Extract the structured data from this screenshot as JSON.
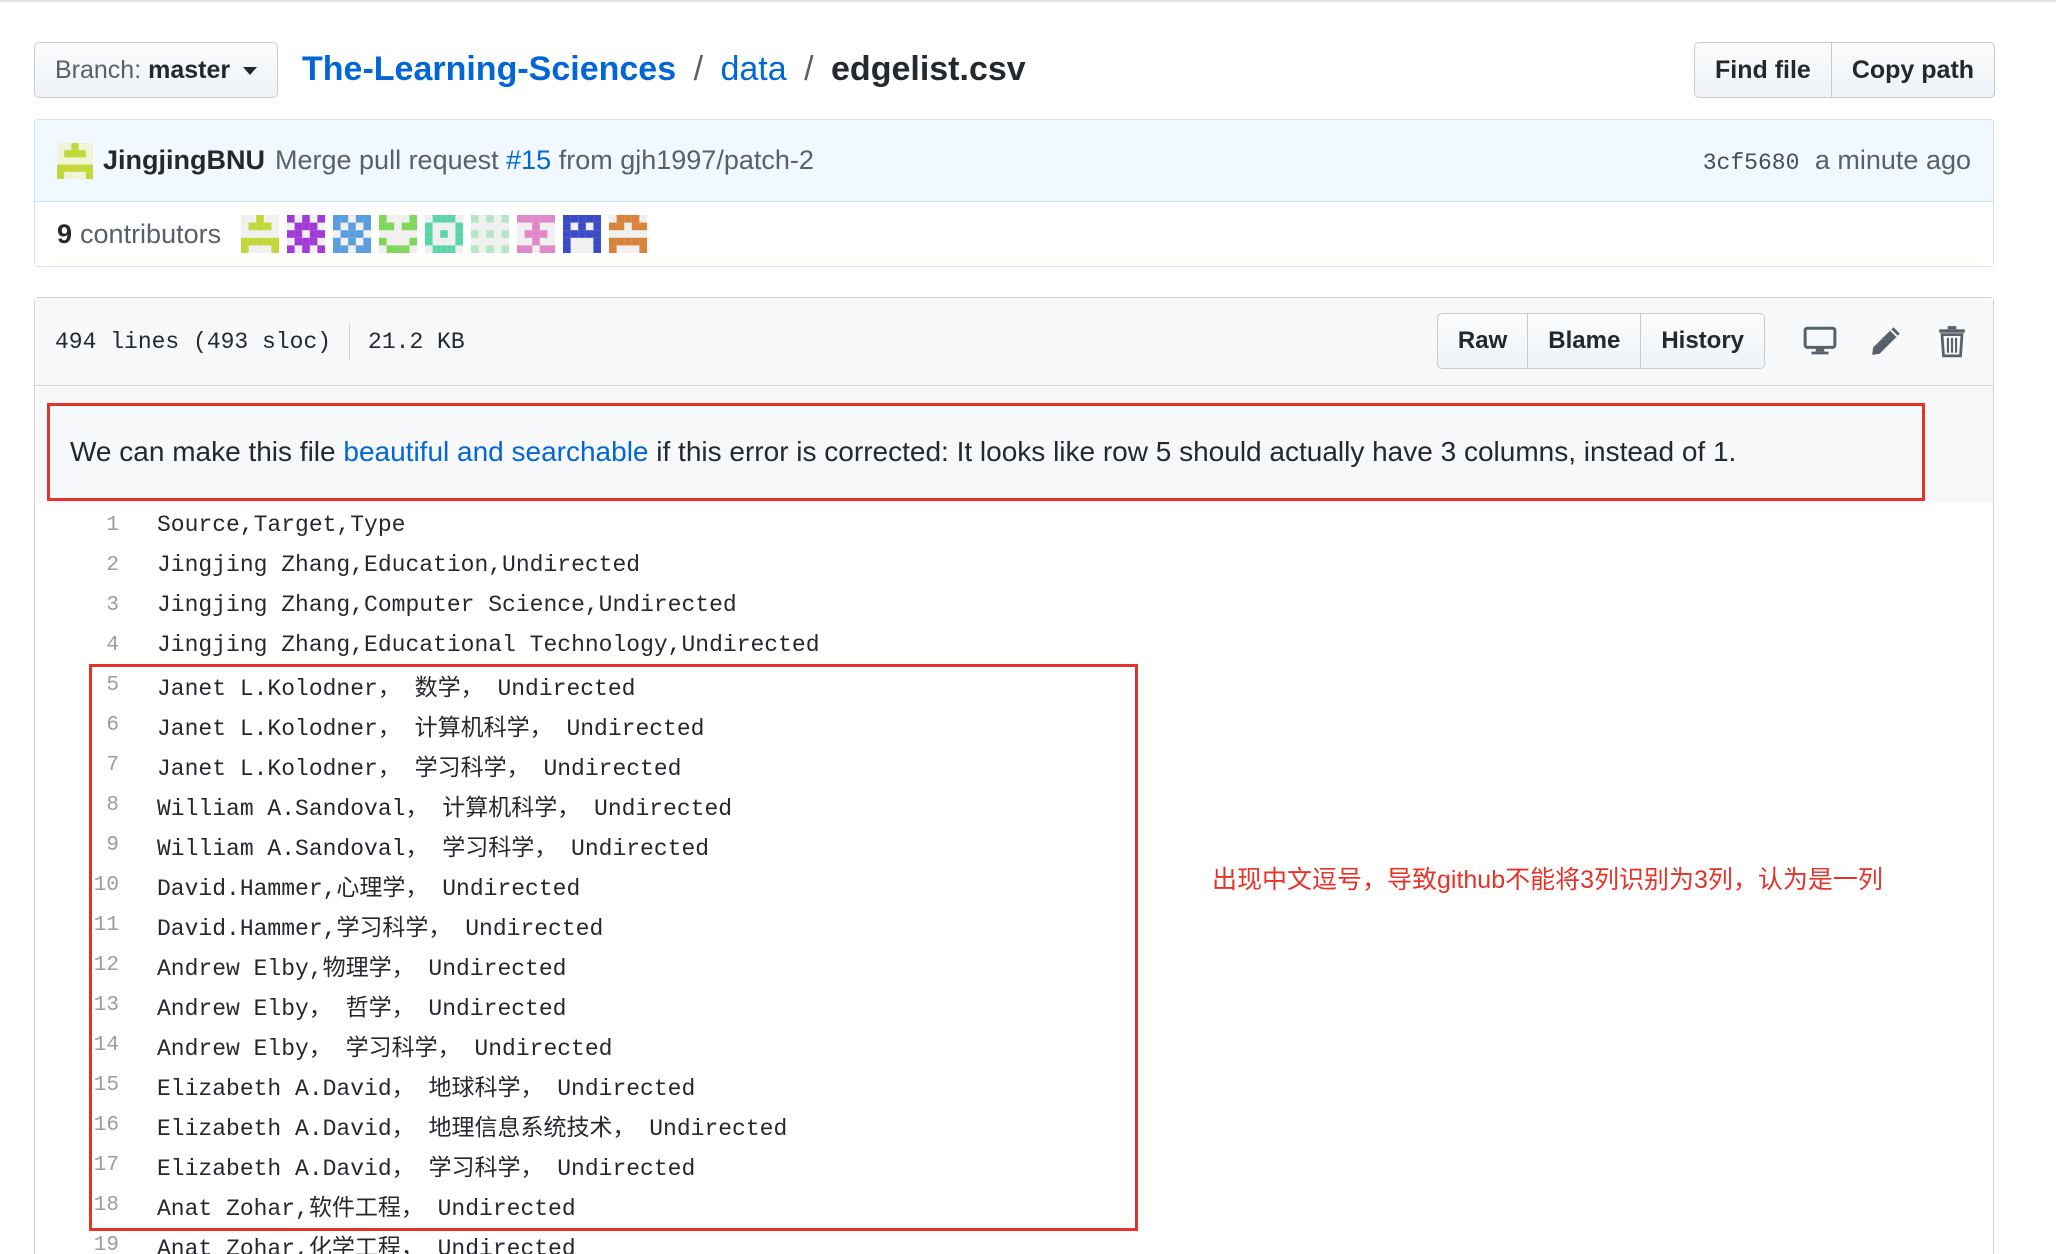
{
  "header": {
    "branch_label": "Branch:",
    "branch_value": "master",
    "repo": "The-Learning-Sciences",
    "folder": "data",
    "file": "edgelist.csv",
    "separator": "/",
    "find_file": "Find file",
    "copy_path": "Copy path"
  },
  "commit": {
    "author": "JingjingBNU",
    "message_prefix": "Merge pull request",
    "pr_link": "#15",
    "message_suffix": "from gjh1997/patch-2",
    "sha": "3cf5680",
    "time": "a minute ago",
    "contributors_count": "9",
    "contributors_label": "contributors",
    "contributor_colors": [
      "#c2d83a",
      "#a23ad8",
      "#5a9ee0",
      "#82d65a",
      "#5ad6a8",
      "#b6e6c8",
      "#e088c8",
      "#3a4ac8",
      "#d8823a"
    ]
  },
  "file_header": {
    "lines": "494 lines (493 sloc)",
    "size": "21.2 KB",
    "raw": "Raw",
    "blame": "Blame",
    "history": "History"
  },
  "error": {
    "prefix": "We can make this file",
    "link": "beautiful and searchable",
    "suffix": "if this error is corrected: It looks like row 5 should actually have 3 columns, instead of 1."
  },
  "code_lines": [
    {
      "n": "1",
      "t": "Source,Target,Type"
    },
    {
      "n": "2",
      "t": "Jingjing Zhang,Education,Undirected"
    },
    {
      "n": "3",
      "t": "Jingjing Zhang,Computer Science,Undirected"
    },
    {
      "n": "4",
      "t": "Jingjing Zhang,Educational Technology,Undirected"
    },
    {
      "n": "5",
      "t": "Janet L.Kolodner， 数学， Undirected"
    },
    {
      "n": "6",
      "t": "Janet L.Kolodner， 计算机科学， Undirected"
    },
    {
      "n": "7",
      "t": "Janet L.Kolodner， 学习科学， Undirected"
    },
    {
      "n": "8",
      "t": "William A.Sandoval， 计算机科学， Undirected"
    },
    {
      "n": "9",
      "t": "William A.Sandoval， 学习科学， Undirected"
    },
    {
      "n": "10",
      "t": "David.Hammer,心理学， Undirected"
    },
    {
      "n": "11",
      "t": "David.Hammer,学习科学， Undirected"
    },
    {
      "n": "12",
      "t": "Andrew Elby,物理学， Undirected"
    },
    {
      "n": "13",
      "t": "Andrew Elby， 哲学， Undirected"
    },
    {
      "n": "14",
      "t": "Andrew Elby， 学习科学， Undirected"
    },
    {
      "n": "15",
      "t": "Elizabeth A.David， 地球科学， Undirected"
    },
    {
      "n": "16",
      "t": "Elizabeth A.David， 地理信息系统技术， Undirected"
    },
    {
      "n": "17",
      "t": "Elizabeth A.David， 学习科学， Undirected"
    },
    {
      "n": "18",
      "t": "Anat Zohar,软件工程， Undirected"
    },
    {
      "n": "19",
      "t": "Anat Zohar,化学工程， Undirected"
    }
  ],
  "annotation": "出现中文逗号，导致github不能将3列识别为3列，认为是一列",
  "colors": {
    "link": "#0366d6",
    "annotation_red": "#e5332a"
  }
}
